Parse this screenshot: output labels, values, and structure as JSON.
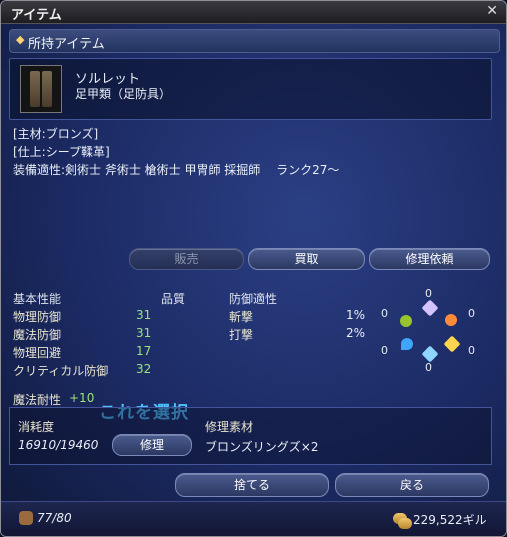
{
  "window": {
    "title": "アイテム"
  },
  "section": {
    "label": "所持アイテム"
  },
  "item": {
    "name": "ソルレット",
    "category": "足甲類（足防具）",
    "material": "[主材:ブロンズ]",
    "finish": "[仕上:シープ鞣革]",
    "equip": "装備適性:剣術士 斧術士 槍術士 甲冑師 採掘師　 ランク27～"
  },
  "actions": {
    "sell": "販売",
    "buyback": "買取",
    "repair_request": "修理依頼"
  },
  "stats": {
    "header_basic": "基本性能",
    "header_quality": "品質",
    "header_resist": "防御適性",
    "rows": [
      {
        "label": "物理防御",
        "value": "31"
      },
      {
        "label": "魔法防御",
        "value": "31"
      },
      {
        "label": "物理回避",
        "value": "17"
      },
      {
        "label": "クリティカル防御",
        "value": "32"
      }
    ],
    "resist_rows": [
      {
        "label": "斬撃",
        "value": "1%"
      },
      {
        "label": "打撃",
        "value": "2%"
      }
    ]
  },
  "elements": {
    "values": [
      "0",
      "0",
      "0",
      "0",
      "0",
      "0"
    ],
    "colors": [
      "#d3c3ff",
      "#ff8a3a",
      "#ffd54d",
      "#8fd6ff",
      "#3fa6ff",
      "#98c52f"
    ],
    "icons": [
      "wind-icon",
      "fire-icon",
      "earth-icon",
      "ice-icon",
      "water-icon",
      "lightning-icon"
    ]
  },
  "magic_resistance": {
    "label": "魔法耐性",
    "value": "+10"
  },
  "annotation": "これを選択",
  "repair": {
    "durability_label": "消耗度",
    "durability_value": "16910/19460",
    "repair_button": "修理",
    "materials_label": "修理素材",
    "materials_value": "ブロンズリングズ×2"
  },
  "bottom_buttons": {
    "discard": "捨てる",
    "back": "戻る"
  },
  "footer": {
    "capacity": "77/80",
    "gil": "229,522ギル"
  }
}
